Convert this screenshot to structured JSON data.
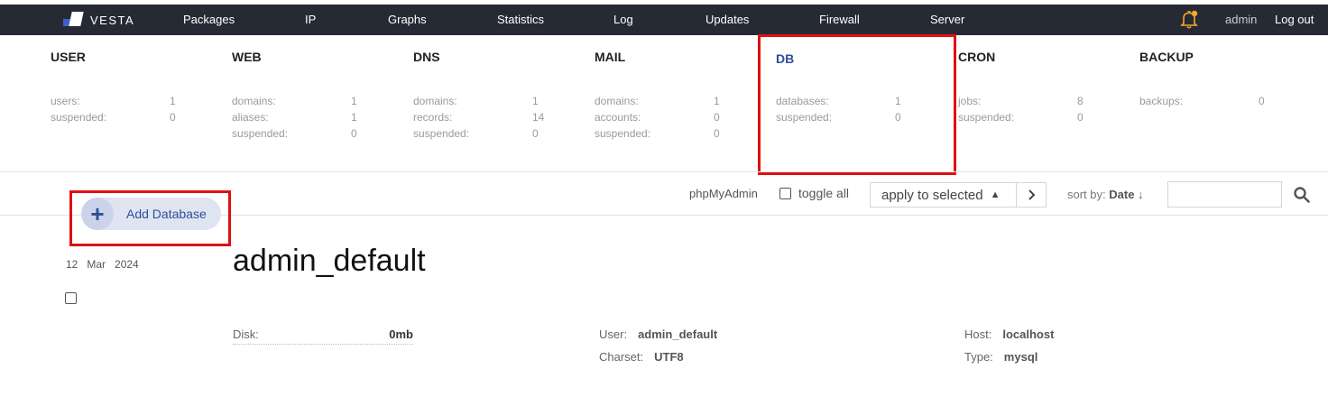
{
  "app": {
    "logo_text": "VESTA"
  },
  "nav": {
    "items": [
      "Packages",
      "IP",
      "Graphs",
      "Statistics",
      "Log",
      "Updates",
      "Firewall",
      "Server"
    ],
    "user": "admin",
    "logout": "Log out"
  },
  "stats": [
    {
      "title": "USER",
      "rows": [
        {
          "label": "users:",
          "value": "1"
        },
        {
          "label": "suspended:",
          "value": "0"
        }
      ]
    },
    {
      "title": "WEB",
      "rows": [
        {
          "label": "domains:",
          "value": "1"
        },
        {
          "label": "aliases:",
          "value": "1"
        },
        {
          "label": "suspended:",
          "value": "0"
        }
      ]
    },
    {
      "title": "DNS",
      "rows": [
        {
          "label": "domains:",
          "value": "1"
        },
        {
          "label": "records:",
          "value": "14"
        },
        {
          "label": "suspended:",
          "value": "0"
        }
      ]
    },
    {
      "title": "MAIL",
      "rows": [
        {
          "label": "domains:",
          "value": "1"
        },
        {
          "label": "accounts:",
          "value": "0"
        },
        {
          "label": "suspended:",
          "value": "0"
        }
      ]
    },
    {
      "title": "DB",
      "rows": [
        {
          "label": "databases:",
          "value": "1"
        },
        {
          "label": "suspended:",
          "value": "0"
        }
      ]
    },
    {
      "title": "CRON",
      "rows": [
        {
          "label": "jobs:",
          "value": "8"
        },
        {
          "label": "suspended:",
          "value": "0"
        }
      ]
    },
    {
      "title": "BACKUP",
      "rows": [
        {
          "label": "backups:",
          "value": "0"
        }
      ]
    }
  ],
  "toolbar": {
    "add_label": "Add Database",
    "phpmyadmin": "phpMyAdmin",
    "toggle_all": "toggle all",
    "apply_selected": "apply to selected",
    "sort_prefix": "sort by:",
    "sort_value": "Date ↓"
  },
  "db": {
    "day": "12",
    "month": "Mar",
    "year": "2024",
    "name": "admin_default",
    "disk_label": "Disk:",
    "disk_value": "0mb",
    "user_label": "User:",
    "user_value": "admin_default",
    "charset_label": "Charset:",
    "charset_value": "UTF8",
    "host_label": "Host:",
    "host_value": "localhost",
    "type_label": "Type:",
    "type_value": "mysql"
  },
  "colors": {
    "nav_bg": "#262a35",
    "accent": "#2f4d9b",
    "highlight": "#e01010",
    "bell": "#f5a623"
  }
}
